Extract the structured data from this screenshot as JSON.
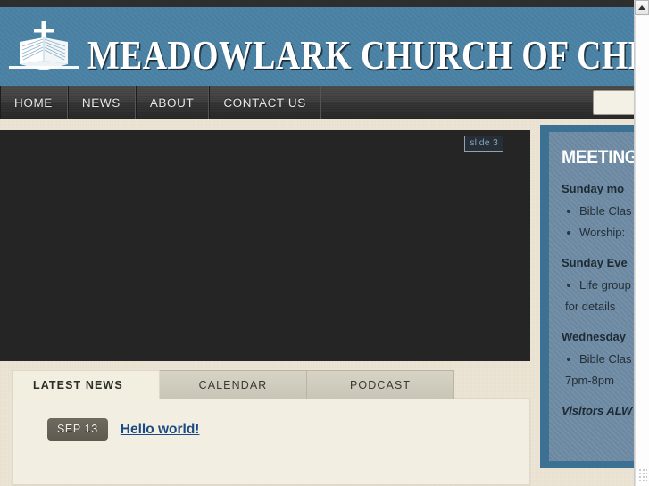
{
  "site": {
    "title": "MEADOWLARK CHURCH OF CHRIST",
    "logo_icon": "open-bible-cross-icon"
  },
  "nav": {
    "items": [
      {
        "label": "HOME"
      },
      {
        "label": "NEWS"
      },
      {
        "label": "ABOUT"
      },
      {
        "label": "CONTACT US"
      }
    ],
    "search": {
      "value": "",
      "placeholder": ""
    }
  },
  "slider": {
    "slide_badge_label": "slide 3"
  },
  "tabs": {
    "items": [
      {
        "label": "LATEST NEWS",
        "active": true
      },
      {
        "label": "CALENDAR",
        "active": false
      },
      {
        "label": "PODCAST",
        "active": false
      }
    ]
  },
  "latest_news": {
    "entries": [
      {
        "date": "SEP 13",
        "title": "Hello world!"
      }
    ]
  },
  "sidebar": {
    "widget": {
      "heading": "MEETING T",
      "sections": [
        {
          "heading": "Sunday mo",
          "items": [
            {
              "text": "Bible Clas",
              "continuation": false
            },
            {
              "text": "Worship:",
              "continuation": false
            }
          ]
        },
        {
          "heading": "Sunday Eve",
          "items": [
            {
              "text": "Life group",
              "continuation": false
            },
            {
              "text": "for details",
              "continuation": true
            }
          ]
        },
        {
          "heading": "Wednesday",
          "items": [
            {
              "text": "Bible Clas",
              "continuation": false
            },
            {
              "text": "7pm-8pm",
              "continuation": true
            }
          ]
        }
      ],
      "footer": "Visitors ALW"
    }
  },
  "scrollbar": {
    "up_arrow_icon": "caret-up-icon",
    "resize_grip_icon": "resize-grip-icon"
  },
  "colors": {
    "banner_blue": "#4a82a5",
    "nav_dark": "#333333",
    "page_cream": "#ece5d4",
    "panel_cream": "#f2efe2",
    "link_blue": "#1c4a82",
    "sidebar_outer_blue": "#3c7194",
    "widget_blue": "#6e8ca5",
    "slider_dark": "#252525",
    "badge_grey": "#645f54"
  }
}
